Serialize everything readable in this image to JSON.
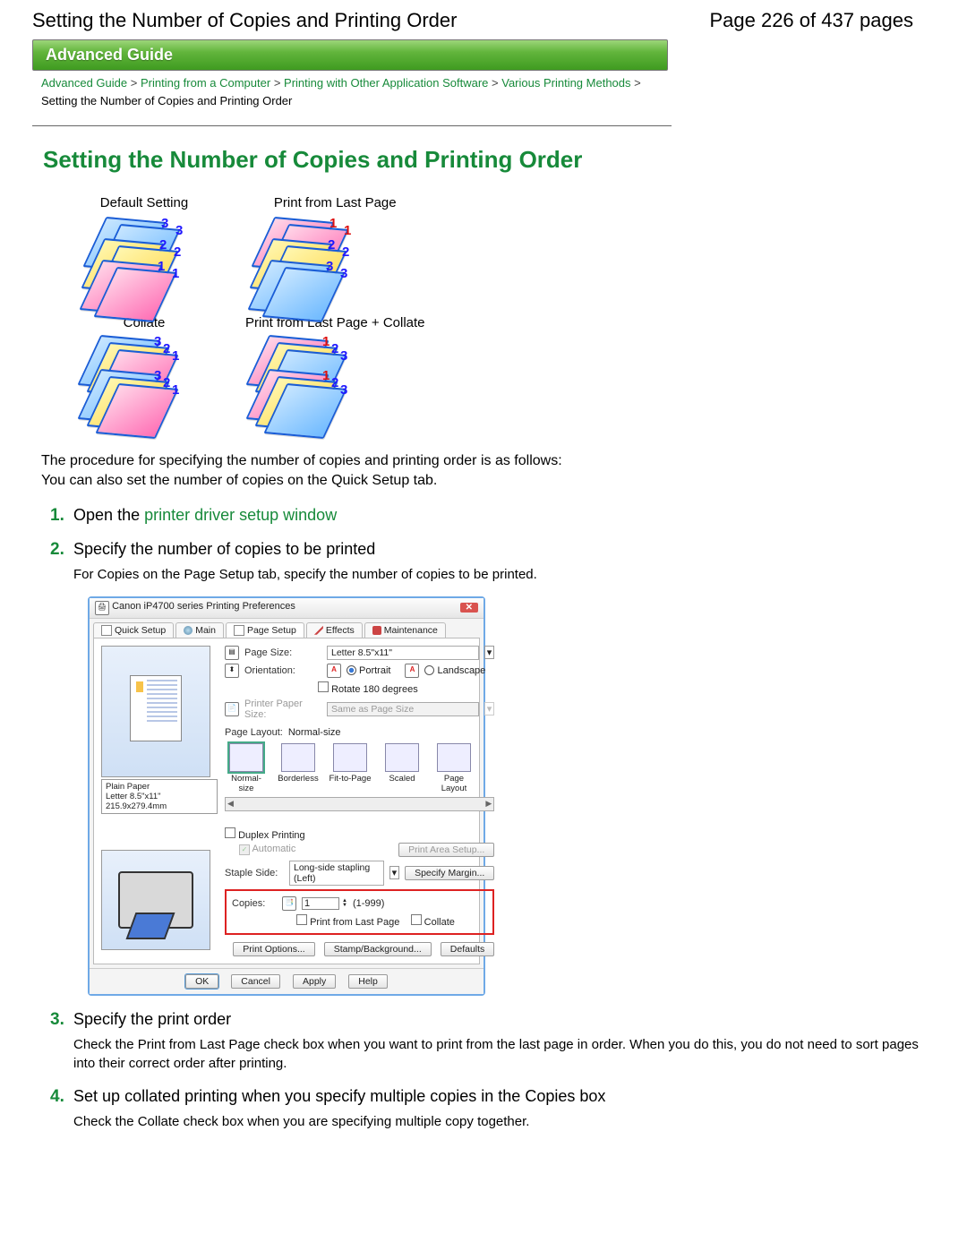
{
  "header": {
    "doc_title": "Setting the Number of Copies and Printing Order",
    "page_indicator": "Page 226 of 437 pages"
  },
  "banner": "Advanced Guide",
  "breadcrumb": {
    "items": [
      "Advanced Guide",
      "Printing from a Computer",
      "Printing with Other Application Software",
      "Various Printing Methods"
    ],
    "current": "Setting the Number of Copies and Printing Order",
    "sep": ">"
  },
  "page_title": "Setting the Number of Copies and Printing Order",
  "thumb_labels": {
    "default": "Default Setting",
    "last": "Print from Last Page",
    "collate": "Collate",
    "last_collate": "Print from Last Page + Collate"
  },
  "intro1": "The procedure for specifying the number of copies and printing order is as follows:",
  "intro2": "You can also set the number of copies on the Quick Setup tab.",
  "steps": [
    {
      "num": "1.",
      "title_pre": "Open the ",
      "title_link": "printer driver setup window",
      "body": ""
    },
    {
      "num": "2.",
      "title_pre": "Specify the number of copies to be printed",
      "title_link": "",
      "body": "For Copies on the Page Setup tab, specify the number of copies to be printed."
    },
    {
      "num": "3.",
      "title_pre": "Specify the print order",
      "title_link": "",
      "body": "Check the Print from Last Page check box when you want to print from the last page in order. When you do this, you do not need to sort pages into their correct order after printing."
    },
    {
      "num": "4.",
      "title_pre": "Set up collated printing when you specify multiple copies in the Copies box",
      "title_link": "",
      "body": "Check the Collate check box when you are specifying multiple copy together."
    }
  ],
  "dialog": {
    "title": "Canon iP4700 series Printing Preferences",
    "tabs": [
      "Quick Setup",
      "Main",
      "Page Setup",
      "Effects",
      "Maintenance"
    ],
    "active_tab": 2,
    "page_size_label": "Page Size:",
    "page_size_value": "Letter 8.5\"x11\"",
    "orientation_label": "Orientation:",
    "orientation_portrait": "Portrait",
    "orientation_landscape": "Landscape",
    "rotate_label": "Rotate 180 degrees",
    "printer_paper_label": "Printer Paper Size:",
    "printer_paper_value": "Same as Page Size",
    "page_layout_label": "Page Layout:",
    "page_layout_value": "Normal-size",
    "layout_options": [
      "Normal-size",
      "Borderless",
      "Fit-to-Page",
      "Scaled",
      "Page Layout"
    ],
    "preview_caption1": "Plain Paper",
    "preview_caption2": "Letter 8.5\"x11\" 215.9x279.4mm",
    "duplex_label": "Duplex Printing",
    "automatic_label": "Automatic",
    "print_area_btn": "Print Area Setup...",
    "staple_label": "Staple Side:",
    "staple_value": "Long-side stapling (Left)",
    "specify_margin_btn": "Specify Margin...",
    "copies_label": "Copies:",
    "copies_value": "1",
    "copies_range": "(1-999)",
    "print_last_label": "Print from Last Page",
    "collate_label": "Collate",
    "btn_print_options": "Print Options...",
    "btn_stamp": "Stamp/Background...",
    "btn_defaults": "Defaults",
    "btn_ok": "OK",
    "btn_cancel": "Cancel",
    "btn_apply": "Apply",
    "btn_help": "Help"
  }
}
